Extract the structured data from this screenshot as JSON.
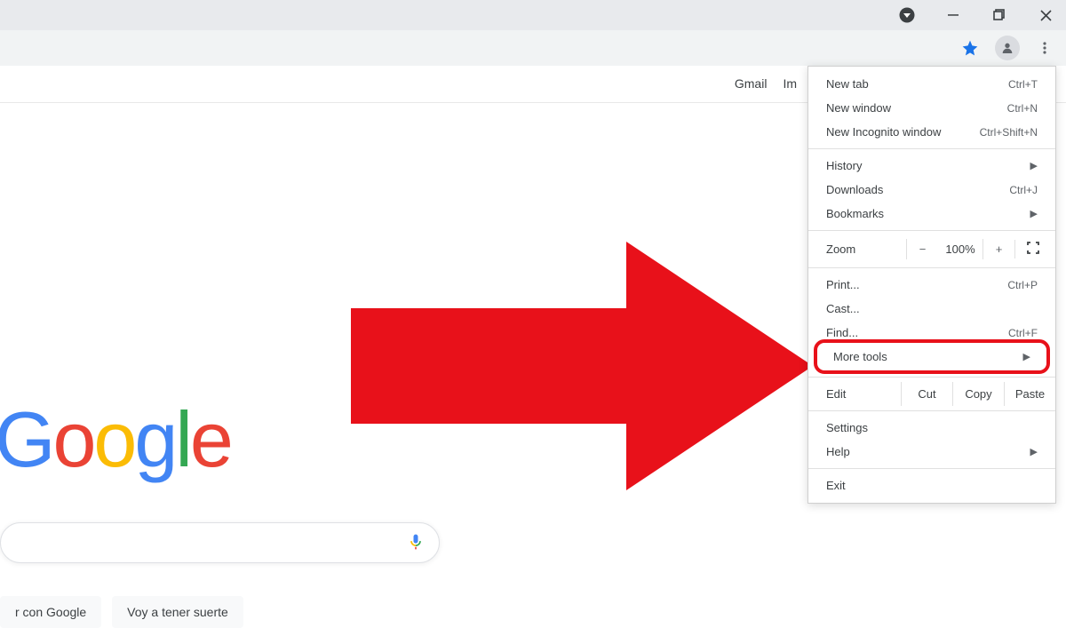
{
  "links": {
    "gmail": "Gmail",
    "images": "Im"
  },
  "buttons": {
    "search": "r con Google",
    "lucky": "Voy a tener suerte"
  },
  "search": {
    "placeholder": ""
  },
  "logo": {
    "g1": "G",
    "o1": "o",
    "o2": "o",
    "g2": "g",
    "l": "l",
    "e": "e"
  },
  "menu": {
    "new_tab": {
      "label": "New tab",
      "shortcut": "Ctrl+T"
    },
    "new_window": {
      "label": "New window",
      "shortcut": "Ctrl+N"
    },
    "incognito": {
      "label": "New Incognito window",
      "shortcut": "Ctrl+Shift+N"
    },
    "history": {
      "label": "History"
    },
    "downloads": {
      "label": "Downloads",
      "shortcut": "Ctrl+J"
    },
    "bookmarks": {
      "label": "Bookmarks"
    },
    "zoom": {
      "label": "Zoom",
      "minus": "−",
      "value": "100%",
      "plus": "+"
    },
    "print": {
      "label": "Print...",
      "shortcut": "Ctrl+P"
    },
    "cast": {
      "label": "Cast..."
    },
    "find": {
      "label": "Find...",
      "shortcut": "Ctrl+F"
    },
    "more_tools": {
      "label": "More tools"
    },
    "edit": {
      "label": "Edit",
      "cut": "Cut",
      "copy": "Copy",
      "paste": "Paste"
    },
    "settings": {
      "label": "Settings"
    },
    "help": {
      "label": "Help"
    },
    "exit": {
      "label": "Exit"
    }
  }
}
